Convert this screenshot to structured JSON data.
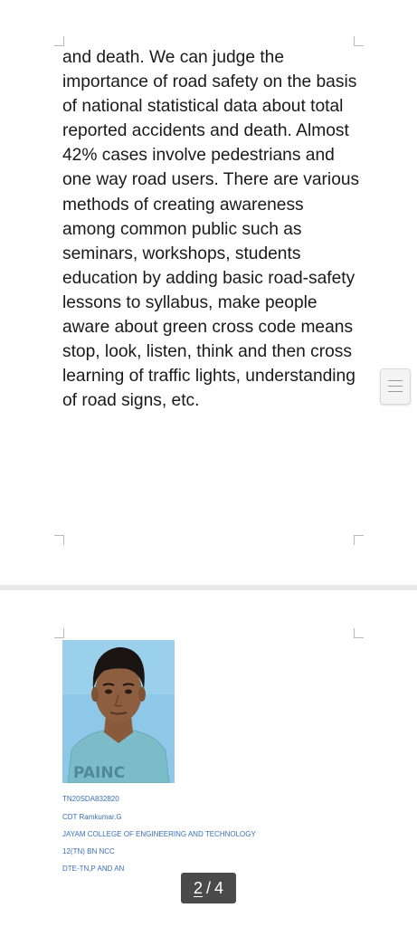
{
  "document": {
    "page1": {
      "paragraph": "and death. We can judge the importance of road safety on the basis of national statistical data about total reported accidents and death. Almost 42% cases involve pedestrians and one way road users. There are various methods of creating awareness among common public such as seminars, workshops, students education by adding basic road-safety lessons to syllabus, make people aware about green cross code means stop, look, listen, think and then cross learning of traffic lights, understanding of road signs, etc."
    },
    "page2": {
      "photo_text": "PAINC",
      "lines": [
        "TN20SDA832820",
        "CDT Ramkumar.G",
        "JAYAM COLLEGE OF ENGINEERING AND TECHNOLOGY",
        "12(TN) BN NCC",
        "DTE-TN,P AND AN"
      ]
    }
  },
  "page_indicator": {
    "current": "2",
    "separator": "/",
    "total": "4"
  },
  "colors": {
    "body_text": "#1a1a1a",
    "meta_text": "#3b6fb6",
    "indicator_bg": "#4a4a4a",
    "page_gap": "#e9e9e9"
  },
  "icons": {
    "scroll_handle": "hamburger-lines-icon"
  }
}
